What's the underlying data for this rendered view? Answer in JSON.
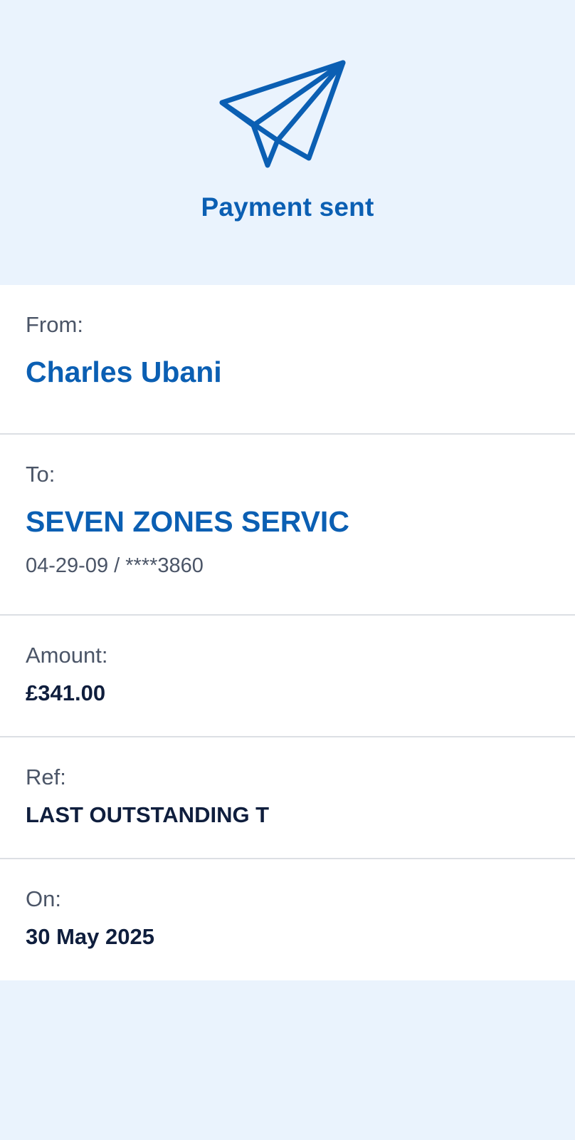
{
  "header": {
    "icon": "paper-plane-icon",
    "title": "Payment sent"
  },
  "from": {
    "label": "From:",
    "name": "Charles Ubani"
  },
  "to": {
    "label": "To:",
    "name": "SEVEN ZONES SERVIC",
    "account": "04-29-09 / ****3860"
  },
  "amount": {
    "label": "Amount:",
    "value": "£341.00"
  },
  "ref": {
    "label": "Ref:",
    "value": "LAST OUTSTANDING T"
  },
  "on": {
    "label": "On:",
    "value": "30 May 2025"
  },
  "colors": {
    "background": "#EAF3FD",
    "accent": "#0B5FB3",
    "text_dark": "#0F1E3D",
    "text_muted": "#4B5567",
    "divider": "#DCDFE4"
  }
}
